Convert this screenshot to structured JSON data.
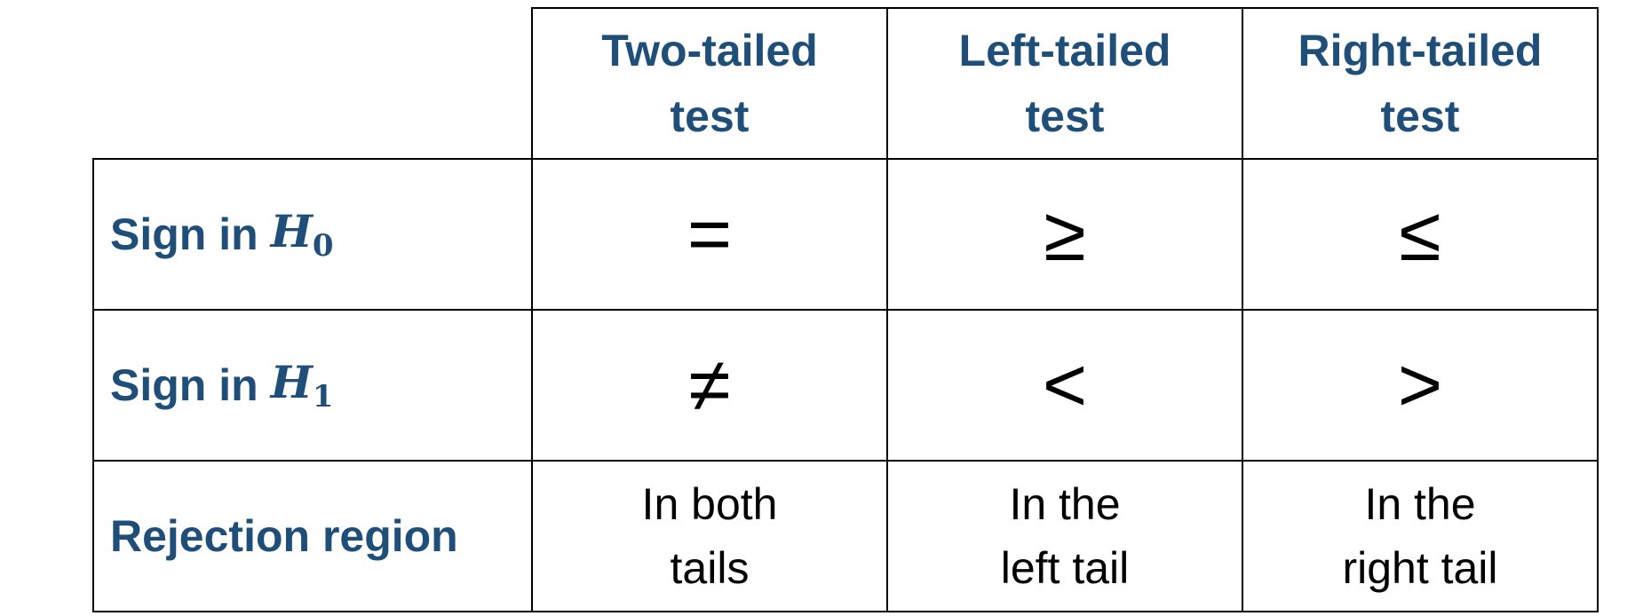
{
  "table": {
    "column_headers": [
      {
        "line1": "Two-tailed",
        "line2": "test"
      },
      {
        "line1": "Left-tailed",
        "line2": "test"
      },
      {
        "line1": "Right-tailed",
        "line2": "test"
      }
    ],
    "rows": [
      {
        "label": "Sign in",
        "label_math": "H",
        "label_sub": "0",
        "cells": [
          "=",
          "≥",
          "≤"
        ]
      },
      {
        "label": "Sign in",
        "label_math": "H",
        "label_sub": "1",
        "cells": [
          "≠",
          "<",
          ">"
        ]
      },
      {
        "label": "Rejection region",
        "cells": [
          {
            "line1": "In both",
            "line2": "tails"
          },
          {
            "line1": "In the",
            "line2": "left tail"
          },
          {
            "line1": "In the",
            "line2": "right tail"
          }
        ]
      }
    ]
  },
  "colors": {
    "heading": "#1f4e79",
    "body": "#000000",
    "border": "#000000"
  }
}
